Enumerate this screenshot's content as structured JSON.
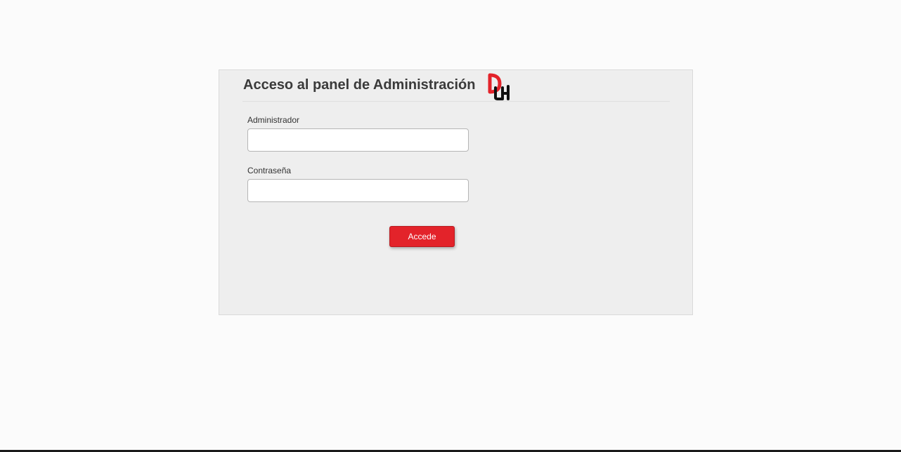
{
  "login": {
    "title": "Acceso al panel de Administración",
    "logo_icon": "dh-logo-icon",
    "admin_label": "Administrador",
    "admin_value": "",
    "password_label": "Contraseña",
    "password_value": "",
    "submit_label": "Accede"
  },
  "colors": {
    "accent": "#e3232a",
    "panel_background": "#eeeeee",
    "title_text": "#3a3a3a"
  }
}
